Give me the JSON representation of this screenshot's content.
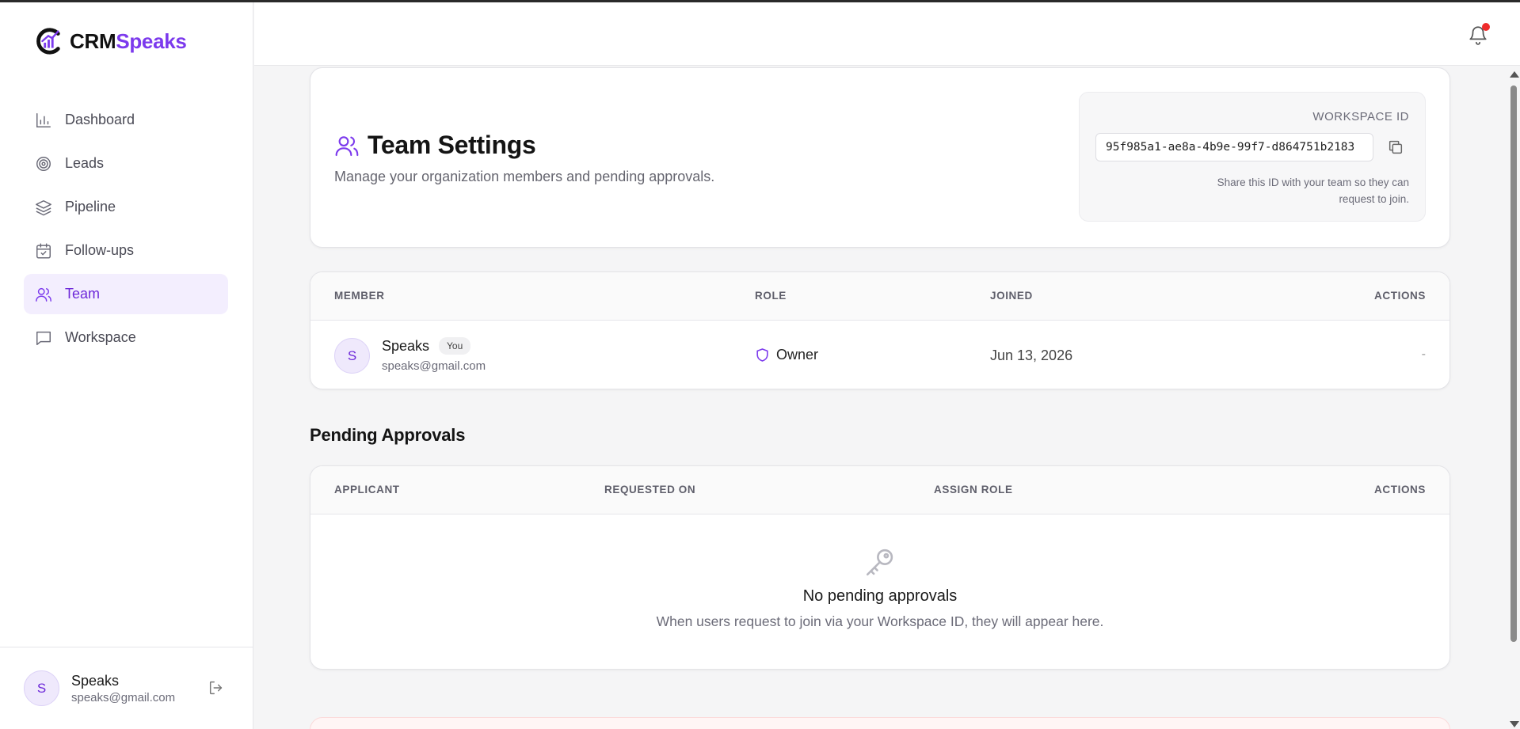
{
  "app": {
    "brand_part1": "CRM",
    "brand_part2": "Speaks",
    "accent_color": "#7c3aed"
  },
  "sidebar": {
    "items": [
      {
        "label": "Dashboard",
        "icon": "bar-chart-icon"
      },
      {
        "label": "Leads",
        "icon": "target-icon"
      },
      {
        "label": "Pipeline",
        "icon": "layers-icon"
      },
      {
        "label": "Follow-ups",
        "icon": "calendar-check-icon"
      },
      {
        "label": "Team",
        "icon": "users-icon",
        "active": true
      },
      {
        "label": "Workspace",
        "icon": "message-square-icon"
      }
    ],
    "user": {
      "initial": "S",
      "name": "Speaks",
      "email": "speaks@gmail.com"
    }
  },
  "topbar": {
    "notification_icon": "bell-icon",
    "has_unread": true
  },
  "team_settings": {
    "title": "Team Settings",
    "subtitle": "Manage your organization members and pending approvals.",
    "workspace": {
      "label": "WORKSPACE ID",
      "id": "95f985a1-ae8a-4b9e-99f7-d864751b2183",
      "help": "Share this ID with your team so they can request to join."
    }
  },
  "members": {
    "headers": {
      "member": "MEMBER",
      "role": "ROLE",
      "joined": "JOINED",
      "actions": "ACTIONS"
    },
    "rows": [
      {
        "initial": "S",
        "name": "Speaks",
        "badge": "You",
        "email": "speaks@gmail.com",
        "role": "Owner",
        "joined": "Jun 13, 2026",
        "actions": "-"
      }
    ]
  },
  "pending": {
    "title": "Pending Approvals",
    "headers": {
      "applicant": "APPLICANT",
      "requested_on": "REQUESTED ON",
      "assign_role": "ASSIGN ROLE",
      "actions": "ACTIONS"
    },
    "empty_title": "No pending approvals",
    "empty_sub": "When users request to join via your Workspace ID, they will appear here."
  }
}
